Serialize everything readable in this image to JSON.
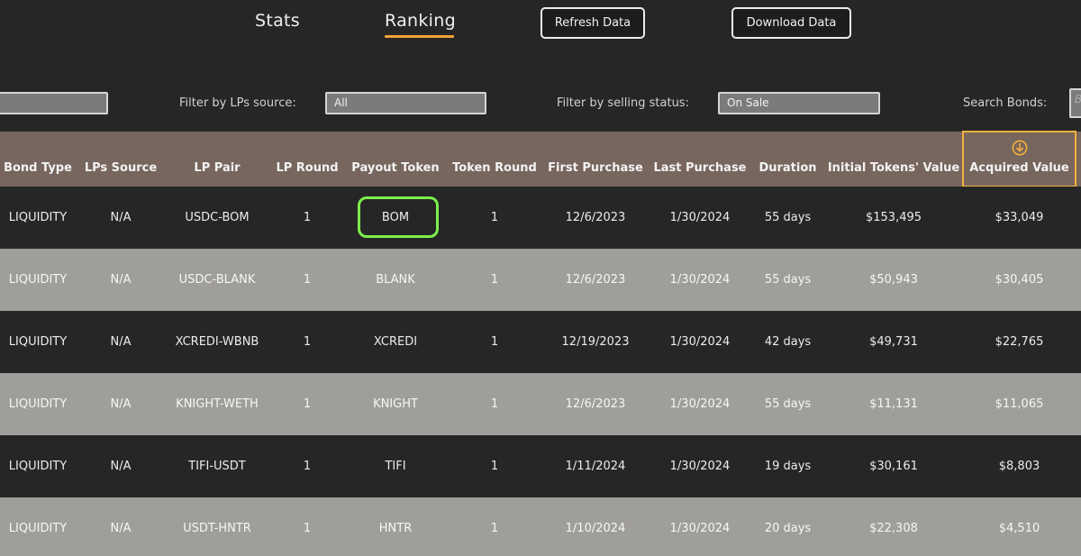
{
  "nav": {
    "tabs": [
      {
        "label": "Stats",
        "active": false
      },
      {
        "label": "Ranking",
        "active": true
      }
    ],
    "refresh_label": "Refresh Data",
    "download_label": "Download Data",
    "accent_color": "#f2a43a"
  },
  "filters": {
    "left_value": "",
    "lps_source_label": "Filter by LPs source:",
    "lps_source_value": "All",
    "selling_status_label": "Filter by selling status:",
    "selling_status_value": "On Sale",
    "search_label": "Search Bonds:",
    "search_placeholder": "B"
  },
  "table": {
    "columns": [
      "Bond Type",
      "LPs Source",
      "LP Pair",
      "LP Round",
      "Payout Token",
      "Token Round",
      "First Purchase",
      "Last Purchase",
      "Duration",
      "Initial Tokens' Value",
      "Acquired Value"
    ],
    "sorted_column": "Acquired Value",
    "sort_direction": "descending",
    "sort_icon": "arrow-down-circle-icon",
    "highlight_color": "#7cf04c",
    "rows": [
      [
        "LIQUIDITY",
        "N/A",
        "USDC-BOM",
        "1",
        "BOM",
        "1",
        "12/6/2023",
        "1/30/2024",
        "55 days",
        "$153,495",
        "$33,049"
      ],
      [
        "LIQUIDITY",
        "N/A",
        "USDC-BLANK",
        "1",
        "BLANK",
        "1",
        "12/6/2023",
        "1/30/2024",
        "55 days",
        "$50,943",
        "$30,405"
      ],
      [
        "LIQUIDITY",
        "N/A",
        "XCREDI-WBNB",
        "1",
        "XCREDI",
        "1",
        "12/19/2023",
        "1/30/2024",
        "42 days",
        "$49,731",
        "$22,765"
      ],
      [
        "LIQUIDITY",
        "N/A",
        "KNIGHT-WETH",
        "1",
        "KNIGHT",
        "1",
        "12/6/2023",
        "1/30/2024",
        "55 days",
        "$11,131",
        "$11,065"
      ],
      [
        "LIQUIDITY",
        "N/A",
        "TIFI-USDT",
        "1",
        "TIFI",
        "1",
        "1/11/2024",
        "1/30/2024",
        "19 days",
        "$30,161",
        "$8,803"
      ],
      [
        "LIQUIDITY",
        "N/A",
        "USDT-HNTR",
        "1",
        "HNTR",
        "1",
        "1/10/2024",
        "1/30/2024",
        "20 days",
        "$22,308",
        "$4,510"
      ]
    ]
  }
}
